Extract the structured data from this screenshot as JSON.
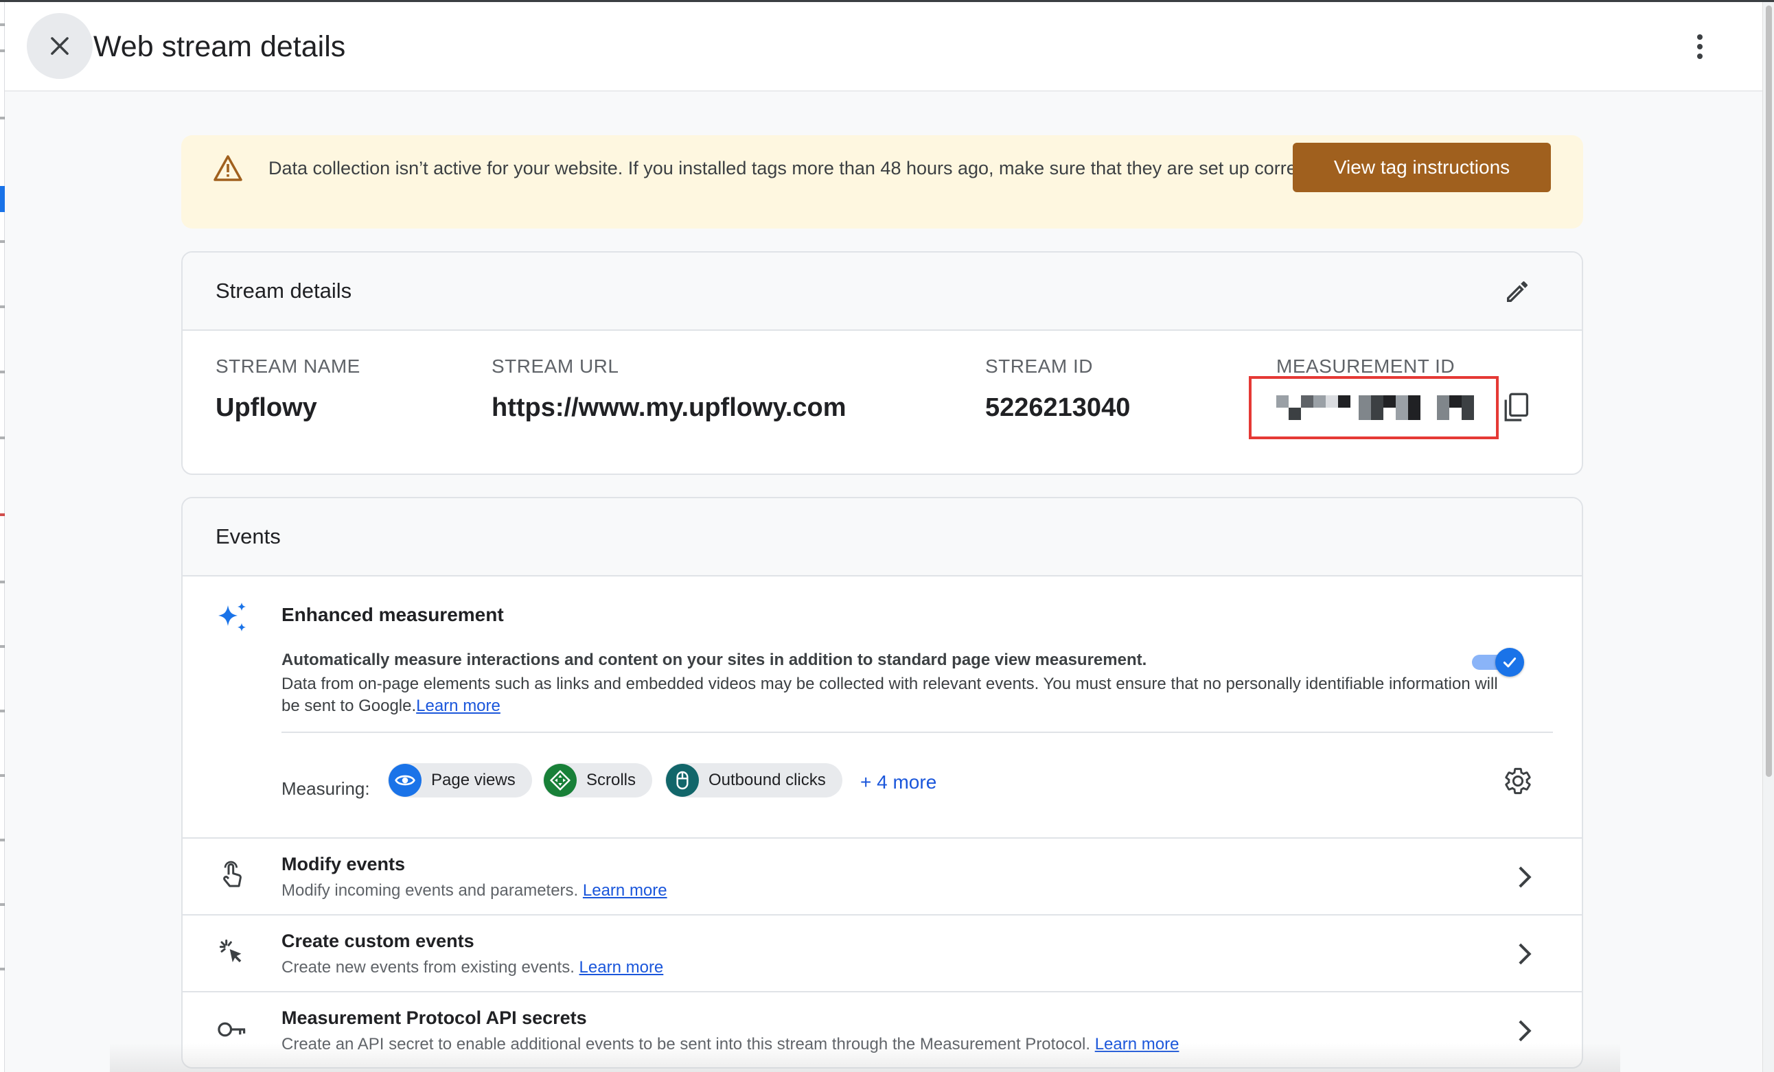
{
  "header": {
    "title": "Web stream details"
  },
  "alert": {
    "message": "Data collection isn’t active for your website. If you installed tags more than 48 hours ago, make sure that they are set up correctly.",
    "button_label": "View tag instructions"
  },
  "stream_details": {
    "title": "Stream details",
    "fields": [
      {
        "label": "STREAM NAME",
        "value": "Upflowy"
      },
      {
        "label": "STREAM URL",
        "value": "https://www.my.upflowy.com"
      },
      {
        "label": "STREAM ID",
        "value": "5226213040"
      },
      {
        "label": "MEASUREMENT ID",
        "value": ""
      }
    ]
  },
  "events": {
    "title": "Events",
    "enhanced": {
      "title": "Enhanced measurement",
      "desc_strong": "Automatically measure interactions and content on your sites in addition to standard page view measurement.",
      "desc": "Data from on-page elements such as links and embedded videos may be collected with relevant events. You must ensure that no personally identifiable information will be sent to Google.",
      "learn_more": "Learn more",
      "toggle_on": true,
      "measuring_label": "Measuring:",
      "chips": [
        {
          "label": "Page views",
          "icon": "eye-icon",
          "color": "#1a73e8"
        },
        {
          "label": "Scrolls",
          "icon": "move-icon",
          "color": "#188038"
        },
        {
          "label": "Outbound clicks",
          "icon": "mouse-icon",
          "color": "#12666a"
        }
      ],
      "more_label": "+ 4 more"
    },
    "rows": [
      {
        "title": "Modify events",
        "sub": "Modify incoming events and parameters.",
        "link": "Learn more",
        "icon": "touch-icon"
      },
      {
        "title": "Create custom events",
        "sub": "Create new events from existing events.",
        "link": "Learn more",
        "icon": "click-sparkle-icon"
      },
      {
        "title": "Measurement Protocol API secrets",
        "sub": "Create an API secret to enable additional events to be sent into this stream through the Measurement Protocol.",
        "link": "Learn more",
        "icon": "key-icon"
      }
    ]
  },
  "colors": {
    "accent": "#1a73e8",
    "alert_bg": "#fef7e0",
    "alert_button": "#a0601e",
    "highlight_box": "#e53935"
  }
}
